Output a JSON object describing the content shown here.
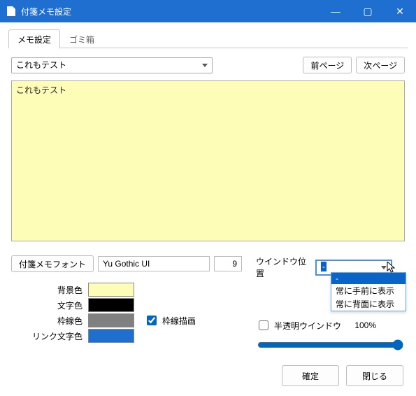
{
  "title": "付箋メモ設定",
  "win_buttons": {
    "min": "—",
    "max": "▢",
    "close": "✕"
  },
  "tabs": {
    "memo": "メモ設定",
    "trash": "ゴミ箱"
  },
  "memo_select": "これもテスト",
  "page": {
    "prev": "前ページ",
    "next": "次ページ"
  },
  "preview_text": "これもテスト",
  "font": {
    "button": "付箋メモフォント",
    "name": "Yu Gothic UI",
    "size": "9"
  },
  "colors": {
    "bg_label": "背景色",
    "bg": "#fdfdb8",
    "fg_label": "文字色",
    "fg": "#000000",
    "border_label": "枠線色",
    "border": "#808080",
    "link_label": "リンク文字色",
    "link": "#1f6fd0"
  },
  "draw_border": {
    "label": "枠線描画",
    "checked": true
  },
  "window_position": {
    "label": "ウインドウ位置",
    "value": "-",
    "options": [
      "-",
      "常に手前に表示",
      "常に背面に表示"
    ]
  },
  "translucent": {
    "label": "半透明ウインドウ",
    "checked": false,
    "value": "100%"
  },
  "dialog": {
    "ok": "確定",
    "close": "閉じる"
  }
}
